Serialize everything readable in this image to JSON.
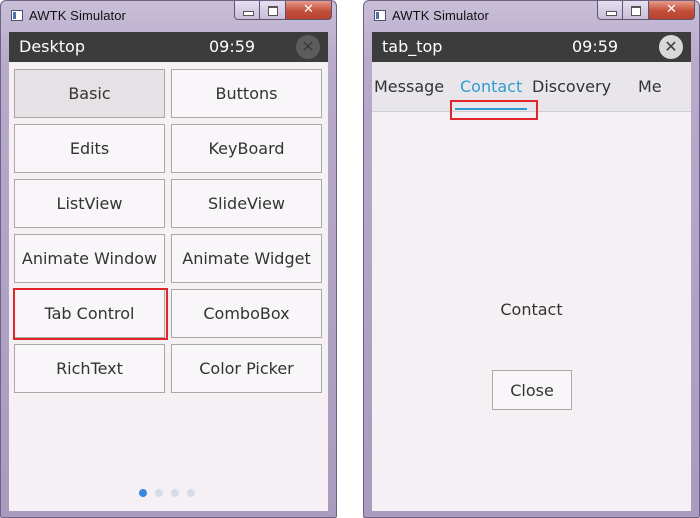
{
  "left_window": {
    "title": "AWTK Simulator",
    "header": {
      "name": "Desktop",
      "clock": "09:59",
      "close_glyph": "✕"
    },
    "buttons": [
      {
        "label": "Basic"
      },
      {
        "label": "Buttons"
      },
      {
        "label": "Edits"
      },
      {
        "label": "KeyBoard"
      },
      {
        "label": "ListView"
      },
      {
        "label": "SlideView"
      },
      {
        "label": "Animate Window"
      },
      {
        "label": "Animate Widget"
      },
      {
        "label": "Tab Control"
      },
      {
        "label": "ComboBox"
      },
      {
        "label": "RichText"
      },
      {
        "label": "Color Picker"
      }
    ],
    "pager": {
      "pages": 4,
      "active": 1
    }
  },
  "right_window": {
    "title": "AWTK Simulator",
    "header": {
      "name": "tab_top",
      "clock": "09:59",
      "close_glyph": "✕"
    },
    "tabs": [
      {
        "label": "Message"
      },
      {
        "label": "Contact"
      },
      {
        "label": "Discovery"
      },
      {
        "label": "Me"
      }
    ],
    "active_tab": "Contact",
    "content_label": "Contact",
    "close_button": "Close"
  },
  "colors": {
    "highlight": "#e0262a",
    "active_tab": "#2f9bd0",
    "header_bg": "#3c3c3c",
    "pager_active": "#3a87e0"
  },
  "icons": {
    "window_close": "close-icon",
    "app": "awtk-app-icon"
  }
}
